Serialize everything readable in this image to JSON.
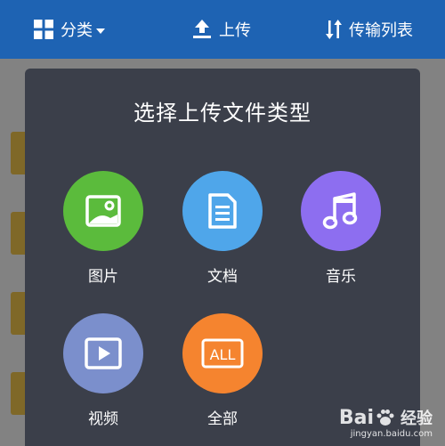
{
  "toolbar": {
    "category_label": "分类",
    "upload_label": "上传",
    "transfer_label": "传输列表"
  },
  "dialog": {
    "title": "选择上传文件类型",
    "options": [
      {
        "label": "图片",
        "icon": "image-icon",
        "color": "#5bbb3c"
      },
      {
        "label": "文档",
        "icon": "document-icon",
        "color": "#4fa6ea"
      },
      {
        "label": "音乐",
        "icon": "music-note-icon",
        "color": "#8d6ef0"
      },
      {
        "label": "视频",
        "icon": "video-play-icon",
        "color": "#7b8fcc"
      },
      {
        "label": "全部",
        "icon": "all-icon",
        "color": "#f5842f"
      }
    ],
    "all_icon_text": "ALL"
  },
  "watermark": {
    "brand_left": "Bai",
    "brand_right": "经验",
    "url": "jingyan.baidu.com"
  },
  "colors": {
    "toolbar_bg": "#1e63b3",
    "dialog_bg": "#3b3f4a",
    "folder": "#e9b528"
  }
}
